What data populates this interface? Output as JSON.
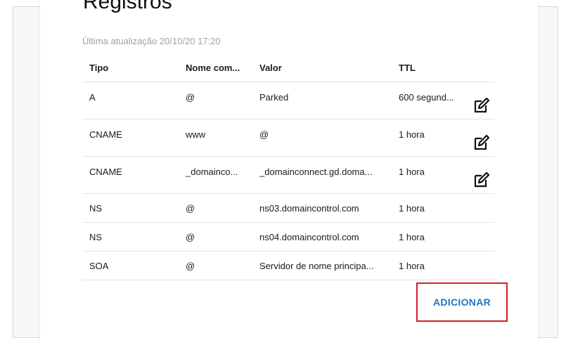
{
  "page": {
    "title": "Registros",
    "last_update": "Última atualização 20/10/20 17:20"
  },
  "table": {
    "headers": [
      "Tipo",
      "Nome com...",
      "Valor",
      "TTL"
    ],
    "rows": [
      {
        "type": "A",
        "name": "@",
        "value": "Parked",
        "ttl": "600 segund...",
        "editable": true
      },
      {
        "type": "CNAME",
        "name": "www",
        "value": "@",
        "ttl": "1 hora",
        "editable": true
      },
      {
        "type": "CNAME",
        "name": "_domainco...",
        "value": "_domainconnect.gd.doma...",
        "ttl": "1 hora",
        "editable": true
      },
      {
        "type": "NS",
        "name": "@",
        "value": "ns03.domaincontrol.com",
        "ttl": "1 hora",
        "editable": false
      },
      {
        "type": "NS",
        "name": "@",
        "value": "ns04.domaincontrol.com",
        "ttl": "1 hora",
        "editable": false
      },
      {
        "type": "SOA",
        "name": "@",
        "value": "Servidor de nome principa...",
        "ttl": "1 hora",
        "editable": false
      }
    ]
  },
  "actions": {
    "add_label": "ADICIONAR"
  },
  "icons": {
    "edit": "edit-icon"
  },
  "colors": {
    "accent": "#1f76c2",
    "highlight_border": "#d32027",
    "muted_text": "#9aa3ad"
  }
}
